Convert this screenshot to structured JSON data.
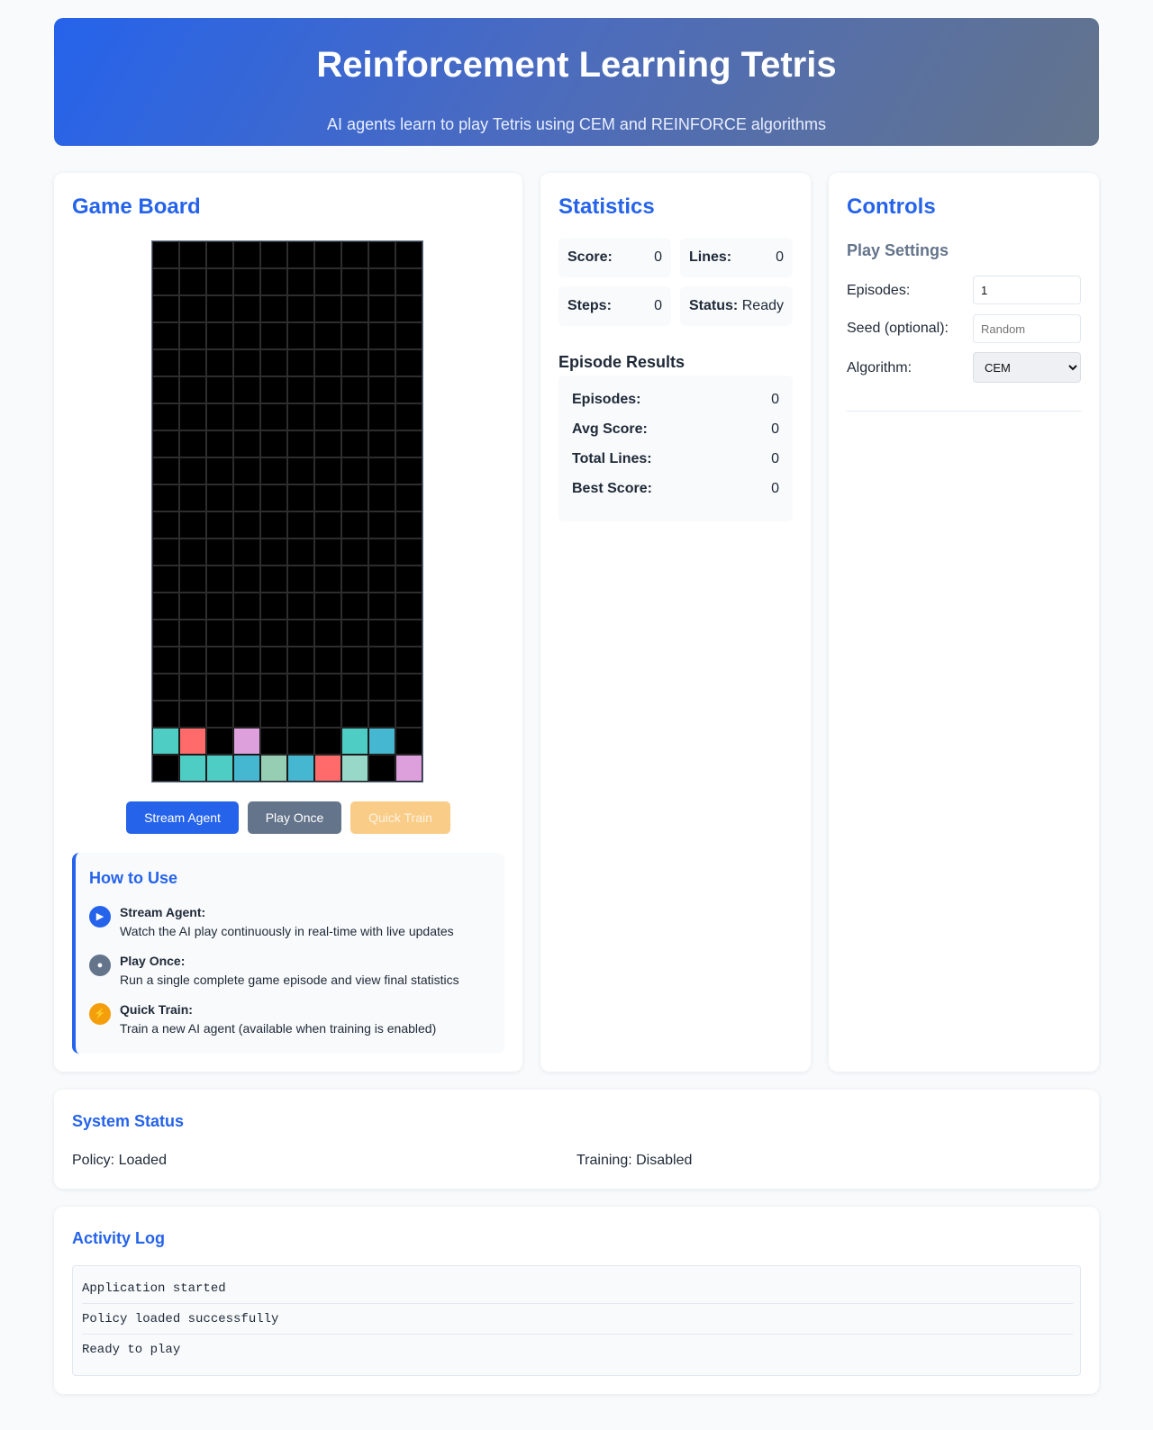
{
  "header": {
    "title": "Reinforcement Learning Tetris",
    "subtitle": "AI agents learn to play Tetris using CEM and REINFORCE algorithms"
  },
  "game": {
    "title": "Game Board",
    "board": {
      "cols": 10,
      "rows": 20,
      "colors": {
        "I": "#4ecdc4",
        "Z": "#ff6b6b",
        "T": "#dda0dd",
        "J": "#45b7d1",
        "S": "#96ceb4",
        "L": "#98d8c8"
      },
      "filled": [
        {
          "row": 18,
          "col": 0,
          "piece": "I"
        },
        {
          "row": 18,
          "col": 1,
          "piece": "Z"
        },
        {
          "row": 18,
          "col": 3,
          "piece": "T"
        },
        {
          "row": 18,
          "col": 7,
          "piece": "I"
        },
        {
          "row": 18,
          "col": 8,
          "piece": "J"
        },
        {
          "row": 19,
          "col": 1,
          "piece": "I"
        },
        {
          "row": 19,
          "col": 2,
          "piece": "I"
        },
        {
          "row": 19,
          "col": 3,
          "piece": "J"
        },
        {
          "row": 19,
          "col": 4,
          "piece": "S"
        },
        {
          "row": 19,
          "col": 5,
          "piece": "J"
        },
        {
          "row": 19,
          "col": 6,
          "piece": "Z"
        },
        {
          "row": 19,
          "col": 7,
          "piece": "L"
        },
        {
          "row": 19,
          "col": 9,
          "piece": "T"
        }
      ]
    },
    "buttons": {
      "stream": "Stream Agent",
      "play": "Play Once",
      "train": "Quick Train"
    },
    "how_to": {
      "title": "How to Use",
      "items": [
        {
          "icon": "play-icon",
          "glyph": "▶",
          "color": "#2563eb",
          "title": "Stream Agent:",
          "desc": "Watch the AI play continuously in real-time with live updates"
        },
        {
          "icon": "dot-icon",
          "glyph": "●",
          "color": "#64748b",
          "title": "Play Once:",
          "desc": "Run a single complete game episode and view final statistics"
        },
        {
          "icon": "lightning-icon",
          "glyph": "⚡",
          "color": "#f59e0b",
          "title": "Quick Train:",
          "desc": "Train a new AI agent (available when training is enabled)"
        }
      ]
    }
  },
  "stats": {
    "title": "Statistics",
    "score_label": "Score:",
    "score": "0",
    "lines_label": "Lines:",
    "lines": "0",
    "steps_label": "Steps:",
    "steps": "0",
    "status_label": "Status:",
    "status": "Ready",
    "results": {
      "title": "Episode Results",
      "rows": [
        {
          "label": "Episodes:",
          "value": "0"
        },
        {
          "label": "Avg Score:",
          "value": "0"
        },
        {
          "label": "Total Lines:",
          "value": "0"
        },
        {
          "label": "Best Score:",
          "value": "0"
        }
      ]
    }
  },
  "controls": {
    "title": "Controls",
    "section": "Play Settings",
    "episodes_label": "Episodes:",
    "episodes_value": "1",
    "seed_label": "Seed (optional):",
    "seed_placeholder": "Random",
    "algorithm_label": "Algorithm:",
    "algorithm_value": "CEM"
  },
  "system": {
    "title": "System Status",
    "policy": "Policy: Loaded",
    "training": "Training: Disabled"
  },
  "log": {
    "title": "Activity Log",
    "lines": [
      "Application started",
      "Policy loaded successfully",
      "Ready to play"
    ]
  }
}
